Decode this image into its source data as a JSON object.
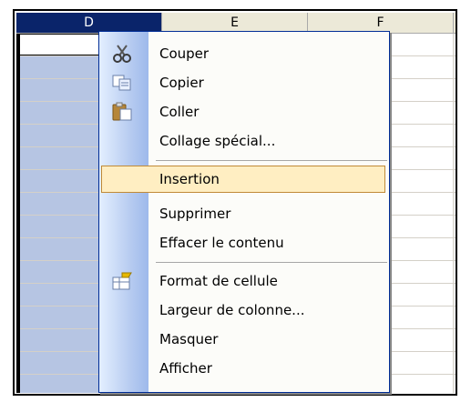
{
  "columns": [
    {
      "key": "D",
      "label": "D",
      "selected": true
    },
    {
      "key": "E",
      "label": "E",
      "selected": false
    },
    {
      "key": "F",
      "label": "F",
      "selected": false
    }
  ],
  "context_menu": {
    "items": [
      {
        "id": "cut",
        "label": "Couper",
        "icon": "scissors-icon",
        "highlighted": false
      },
      {
        "id": "copy",
        "label": "Copier",
        "icon": "copy-icon",
        "highlighted": false
      },
      {
        "id": "paste",
        "label": "Coller",
        "icon": "paste-icon",
        "highlighted": false
      },
      {
        "id": "paste-special",
        "label": "Collage spécial...",
        "icon": "",
        "highlighted": false
      },
      {
        "id": "insert",
        "label": "Insertion",
        "icon": "",
        "highlighted": true
      },
      {
        "id": "delete",
        "label": "Supprimer",
        "icon": "",
        "highlighted": false
      },
      {
        "id": "clear",
        "label": "Effacer le contenu",
        "icon": "",
        "highlighted": false
      },
      {
        "id": "format",
        "label": "Format de cellule",
        "icon": "format-cells-icon",
        "highlighted": false
      },
      {
        "id": "width",
        "label": "Largeur de colonne...",
        "icon": "",
        "highlighted": false
      },
      {
        "id": "hide",
        "label": "Masquer",
        "icon": "",
        "highlighted": false
      },
      {
        "id": "unhide",
        "label": "Afficher",
        "icon": "",
        "highlighted": false
      }
    ]
  },
  "colors": {
    "selected_header": "#0a246a",
    "selected_column": "#b6c5e3",
    "menu_highlight": "#ffeec2",
    "menu_highlight_border": "#c08a37"
  }
}
